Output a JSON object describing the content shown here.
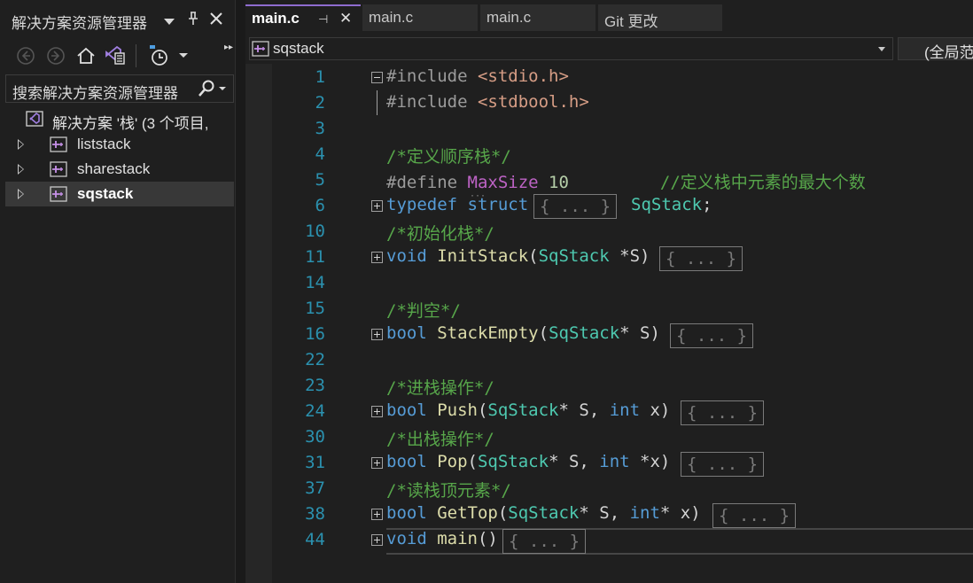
{
  "solution_explorer": {
    "title": "解决方案资源管理器",
    "header_icons": [
      "chevron-down-icon",
      "pin-icon",
      "close-icon"
    ],
    "toolbar_icons": [
      "back-icon",
      "forward-icon",
      "home-icon",
      "vs-switch-views-icon",
      "pending-changes-filter-icon",
      "dropdown-icon"
    ],
    "search_placeholder": "搜索解决方案资源管理器",
    "solution_label": "解决方案 '栈' (3 个项目,",
    "projects": [
      {
        "label": "liststack",
        "selected": false
      },
      {
        "label": "sharestack",
        "selected": false
      },
      {
        "label": "sqstack",
        "selected": true
      }
    ]
  },
  "tabs": [
    {
      "label": "main.c",
      "active": true
    },
    {
      "label": "main.c",
      "active": false
    },
    {
      "label": "main.c",
      "active": false
    },
    {
      "label": "Git 更改",
      "active": false
    }
  ],
  "nav": {
    "project": "sqstack",
    "scope": "(全局范"
  },
  "colors": {
    "accent": "#8f6ccf",
    "keyword": "#569cd6",
    "type": "#4ec9b0",
    "function": "#dcdcaa",
    "string": "#d69d85",
    "comment": "#57a64a",
    "line_number": "#2b91af"
  },
  "code": {
    "l1": {
      "num": "1",
      "pp": "#include ",
      "str": "<stdio.h>"
    },
    "l2": {
      "num": "2",
      "pp": "#include ",
      "str": "<stdbool.h>"
    },
    "l3": {
      "num": "3"
    },
    "l4": {
      "num": "4",
      "cmt": "/*定义顺序栈*/"
    },
    "l5": {
      "num": "5",
      "pp": "#define ",
      "mac": "MaxSize",
      "val": " 10",
      "cmt": "//定义栈中元素的最大个数"
    },
    "l6": {
      "num": "6",
      "kw1": "typedef",
      "kw2": " struct",
      "collapsed": "{ ... }",
      "ty": "SqStack",
      "rest": ";"
    },
    "l10": {
      "num": "10",
      "cmt": "/*初始化栈*/"
    },
    "l11": {
      "num": "11",
      "kw": "void",
      "fn": " InitStack",
      "p1": "(",
      "ty": "SqStack",
      "p2": " *S)",
      "collapsed": "{ ... }"
    },
    "l14": {
      "num": "14"
    },
    "l15": {
      "num": "15",
      "cmt": "/*判空*/"
    },
    "l16": {
      "num": "16",
      "kw": "bool",
      "fn": " StackEmpty",
      "p1": "(",
      "ty": "SqStack",
      "p2": "* S)",
      "collapsed": "{ ... }"
    },
    "l22": {
      "num": "22"
    },
    "l23": {
      "num": "23",
      "cmt": "/*进栈操作*/"
    },
    "l24": {
      "num": "24",
      "kw": "bool",
      "fn": " Push",
      "p1": "(",
      "ty": "SqStack",
      "p2": "* S, ",
      "kw2": "int",
      "p3": " x)",
      "collapsed": "{ ... }"
    },
    "l30": {
      "num": "30",
      "cmt": "/*出栈操作*/"
    },
    "l31": {
      "num": "31",
      "kw": "bool",
      "fn": " Pop",
      "p1": "(",
      "ty": "SqStack",
      "p2": "* S, ",
      "kw2": "int",
      "p3": " *x)",
      "collapsed": "{ ... }"
    },
    "l37": {
      "num": "37",
      "cmt": "/*读栈顶元素*/"
    },
    "l38": {
      "num": "38",
      "kw": "bool",
      "fn": " GetTop",
      "p1": "(",
      "ty": "SqStack",
      "p2": "* S, ",
      "kw2": "int",
      "p3": "* x)",
      "collapsed": "{ ... }"
    },
    "l44": {
      "num": "44",
      "kw": "void",
      "fn": " main",
      "p1": "()",
      "collapsed": "{ ... }"
    }
  }
}
